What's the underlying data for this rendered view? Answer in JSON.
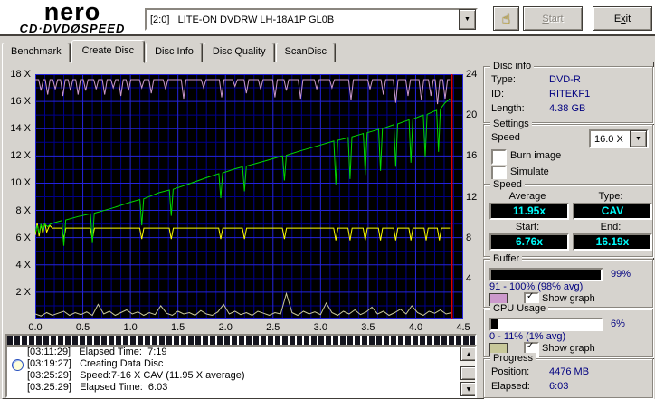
{
  "header": {
    "logo": {
      "name": "nero",
      "line2_left": "CD·DVD",
      "line2_disc": "Ø",
      "line2_right": "SPEED"
    },
    "drive_select": "[2:0]   LITE-ON DVDRW LH-18A1P GL0B",
    "start_u": "S",
    "start_rest": "tart",
    "exit_pre": "E",
    "exit_u": "x",
    "exit_rest": "it"
  },
  "icons": {
    "hand": "☝",
    "dropdown": "▼",
    "up": "▲",
    "down": "▼",
    "check": "✓"
  },
  "tabs": [
    {
      "label": "Benchmark",
      "active": false
    },
    {
      "label": "Create Disc",
      "active": true
    },
    {
      "label": "Disc Info",
      "active": false
    },
    {
      "label": "Disc Quality",
      "active": false
    },
    {
      "label": "ScanDisc",
      "active": false
    }
  ],
  "chart_data": {
    "type": "line",
    "title": "",
    "xlim": [
      0,
      4.5
    ],
    "ylim_left": [
      0,
      18
    ],
    "ylim_right": [
      0,
      24
    ],
    "grid": {
      "x_minor": 0.1,
      "x_major": 0.5,
      "y_minor": 1,
      "y_major": 2,
      "minor_color": "#00008c",
      "major_color": "#2424dd"
    },
    "x_ticks": [
      [
        0,
        "0.0"
      ],
      [
        0.5,
        "0.5"
      ],
      [
        1,
        "1.0"
      ],
      [
        1.5,
        "1.5"
      ],
      [
        2,
        "2.0"
      ],
      [
        2.5,
        "2.5"
      ],
      [
        3,
        "3.0"
      ],
      [
        3.5,
        "3.5"
      ],
      [
        4,
        "4.0"
      ],
      [
        4.5,
        "4.5"
      ]
    ],
    "left_ticks": [
      [
        18,
        "18 X"
      ],
      [
        16,
        "16 X"
      ],
      [
        14,
        "14 X"
      ],
      [
        12,
        "12 X"
      ],
      [
        10,
        "10 X"
      ],
      [
        8,
        "8 X"
      ],
      [
        6,
        "6 X"
      ],
      [
        4,
        "4 X"
      ],
      [
        2,
        "2 X"
      ]
    ],
    "right_ticks": [
      [
        18,
        "24"
      ],
      [
        15,
        "20"
      ],
      [
        12,
        "16"
      ],
      [
        9,
        "12"
      ],
      [
        6,
        "8"
      ],
      [
        3,
        "4"
      ]
    ],
    "end_marker_x": 4.38,
    "end_marker_color": "#dd0000",
    "series": [
      {
        "name": "cpu-usage",
        "color": "#c8c89a",
        "x0": 0,
        "dx": 0.06,
        "values": [
          0.4,
          0.25,
          0.5,
          0.3,
          0.45,
          0.6,
          0.3,
          0.5,
          0.35,
          0.55,
          0.3,
          1.1,
          0.4,
          0.6,
          0.3,
          0.5,
          0.7,
          0.4,
          0.55,
          0.3,
          0.5,
          0.35,
          1.0,
          0.45,
          0.3,
          0.6,
          0.4,
          0.5,
          0.3,
          0.65,
          0.4,
          0.3,
          0.55,
          1.1,
          0.4,
          0.6,
          0.35,
          0.5,
          0.3,
          0.6,
          0.45,
          0.3,
          0.5,
          0.4,
          1.9,
          0.5,
          0.3,
          0.6,
          0.4,
          0.55,
          0.35,
          1.2,
          0.5,
          0.3,
          0.6,
          0.4,
          0.7,
          0.35,
          0.55,
          0.9,
          0.4,
          0.6,
          0.3,
          0.5,
          0.75,
          0.4,
          1.0,
          0.5,
          0.3,
          0.6,
          0.45,
          0.7,
          0.4,
          0.5
        ]
      },
      {
        "name": "buffer-level",
        "color": "#cc99cc",
        "baseline": 17.6,
        "range": [
          0,
          4.36
        ],
        "hw": 0.025,
        "dips": [
          [
            0.06,
            16.8
          ],
          [
            0.13,
            16.5
          ],
          [
            0.21,
            16.9
          ],
          [
            0.29,
            16.4
          ],
          [
            0.37,
            16.8
          ],
          [
            0.45,
            16.5
          ],
          [
            0.53,
            16.8
          ],
          [
            0.64,
            16.9
          ],
          [
            0.73,
            16.5
          ],
          [
            0.82,
            17.0
          ],
          [
            0.9,
            16.4
          ],
          [
            0.98,
            16.8
          ],
          [
            1.12,
            17.0
          ],
          [
            1.22,
            16.6
          ],
          [
            1.37,
            16.9
          ],
          [
            1.56,
            16.2
          ],
          [
            1.77,
            17.0
          ],
          [
            1.96,
            16.3
          ],
          [
            2.1,
            17.1
          ],
          [
            2.22,
            16.6
          ],
          [
            2.37,
            16.9
          ],
          [
            2.52,
            16.3
          ],
          [
            2.64,
            16.8
          ],
          [
            2.79,
            16.2
          ],
          [
            2.96,
            16.9
          ],
          [
            3.12,
            17.0
          ],
          [
            3.32,
            16.1
          ],
          [
            3.52,
            16.9
          ],
          [
            3.66,
            16.5
          ],
          [
            3.79,
            15.9
          ],
          [
            3.92,
            16.4
          ],
          [
            4.06,
            16.1
          ],
          [
            4.16,
            16.4
          ],
          [
            4.23,
            15.8
          ],
          [
            4.31,
            16.2
          ]
        ]
      },
      {
        "name": "yellow-line",
        "color": "#ffff00",
        "baseline": 6.7,
        "range": [
          0.18,
          4.36
        ],
        "hw": 0.022,
        "head": [
          [
            0,
            6.2
          ],
          [
            0.02,
            7.1
          ],
          [
            0.04,
            6.1
          ],
          [
            0.06,
            7.0
          ],
          [
            0.08,
            6.3
          ],
          [
            0.1,
            7.1
          ],
          [
            0.12,
            6.4
          ],
          [
            0.15,
            6.9
          ]
        ],
        "dips": [
          [
            0.3,
            5.9
          ],
          [
            0.6,
            5.9
          ],
          [
            1.12,
            5.9
          ],
          [
            1.43,
            5.9
          ],
          [
            1.95,
            5.9
          ],
          [
            2.2,
            5.9
          ],
          [
            2.62,
            5.9
          ],
          [
            3.16,
            5.8
          ],
          [
            3.31,
            5.8
          ],
          [
            3.47,
            5.8
          ],
          [
            3.63,
            5.8
          ],
          [
            3.79,
            5.8
          ],
          [
            3.95,
            5.8
          ],
          [
            4.11,
            5.8
          ],
          [
            4.25,
            5.8
          ]
        ]
      },
      {
        "name": "write-speed",
        "color": "#00d800",
        "points": [
          [
            0,
            6.4
          ],
          [
            0.02,
            6.9
          ],
          [
            0.04,
            6.3
          ],
          [
            0.06,
            7.0
          ],
          [
            0.08,
            6.5
          ],
          [
            0.1,
            7.0
          ],
          [
            0.13,
            6.8
          ],
          [
            0.16,
            7.0
          ],
          [
            0.2,
            7.1
          ],
          [
            0.28,
            7.25
          ],
          [
            0.3,
            5.4
          ],
          [
            0.32,
            7.3
          ],
          [
            0.45,
            7.55
          ],
          [
            0.58,
            7.75
          ],
          [
            0.6,
            5.6
          ],
          [
            0.62,
            7.8
          ],
          [
            0.8,
            8.15
          ],
          [
            1.0,
            8.6
          ],
          [
            1.1,
            8.8
          ],
          [
            1.12,
            6.9
          ],
          [
            1.14,
            8.85
          ],
          [
            1.3,
            9.3
          ],
          [
            1.41,
            9.5
          ],
          [
            1.43,
            7.6
          ],
          [
            1.45,
            9.55
          ],
          [
            1.6,
            9.9
          ],
          [
            1.8,
            10.4
          ],
          [
            1.93,
            10.7
          ],
          [
            1.95,
            8.9
          ],
          [
            1.97,
            10.75
          ],
          [
            2.1,
            11.05
          ],
          [
            2.18,
            11.2
          ],
          [
            2.2,
            9.4
          ],
          [
            2.22,
            11.25
          ],
          [
            2.4,
            11.6
          ],
          [
            2.6,
            12.0
          ],
          [
            2.62,
            10.2
          ],
          [
            2.64,
            12.05
          ],
          [
            2.8,
            12.4
          ],
          [
            3.0,
            12.8
          ],
          [
            3.12,
            13.05
          ],
          [
            3.14,
            13.1
          ],
          [
            3.16,
            9.9
          ],
          [
            3.18,
            13.15
          ],
          [
            3.27,
            13.3
          ],
          [
            3.29,
            13.35
          ],
          [
            3.31,
            10.3
          ],
          [
            3.33,
            13.4
          ],
          [
            3.43,
            13.6
          ],
          [
            3.45,
            13.65
          ],
          [
            3.47,
            10.6
          ],
          [
            3.49,
            13.7
          ],
          [
            3.59,
            13.9
          ],
          [
            3.61,
            13.95
          ],
          [
            3.63,
            10.9
          ],
          [
            3.65,
            14.0
          ],
          [
            3.75,
            14.25
          ],
          [
            3.77,
            14.3
          ],
          [
            3.79,
            11.2
          ],
          [
            3.81,
            14.35
          ],
          [
            3.91,
            14.6
          ],
          [
            3.93,
            14.65
          ],
          [
            3.95,
            11.5
          ],
          [
            3.97,
            14.7
          ],
          [
            4.06,
            14.95
          ],
          [
            4.08,
            15.0
          ],
          [
            4.1,
            11.9
          ],
          [
            4.12,
            15.05
          ],
          [
            4.2,
            15.3
          ],
          [
            4.22,
            15.35
          ],
          [
            4.24,
            12.3
          ],
          [
            4.26,
            15.45
          ],
          [
            4.31,
            15.9
          ],
          [
            4.36,
            16.2
          ]
        ]
      }
    ]
  },
  "disc_info": {
    "title": "Disc info",
    "rows": [
      [
        "Type:",
        "DVD-R"
      ],
      [
        "ID:",
        "RITEKF1"
      ],
      [
        "Length:",
        "4.38 GB"
      ]
    ]
  },
  "settings": {
    "title": "Settings",
    "speed_label": "Speed",
    "speed_value": "16.0 X",
    "checkboxes": [
      {
        "label": "Burn image",
        "checked": false
      },
      {
        "label": "Simulate",
        "checked": false
      }
    ]
  },
  "speed": {
    "title": "Speed",
    "cells": [
      {
        "label": "Average",
        "value": "11.95x"
      },
      {
        "label": "Type:",
        "value": "CAV"
      },
      {
        "label": "Start:",
        "value": "6.76x"
      },
      {
        "label": "End:",
        "value": "16.19x"
      }
    ]
  },
  "buffer": {
    "title": "Buffer",
    "percent": 99,
    "percent_label": "99%",
    "range_text": "91 - 100% (98% avg)",
    "show_graph_label": "Show graph",
    "swatch_color": "#cc99cc",
    "checked": true
  },
  "cpu": {
    "title": "CPU Usage",
    "percent": 6,
    "percent_label": "6%",
    "range_text": "0 - 11% (1% avg)",
    "show_graph_label": "Show graph",
    "swatch_color": "#c8c89a",
    "checked": true
  },
  "progress": {
    "title": "Progress",
    "rows": [
      [
        "Position:",
        "4476 MB"
      ],
      [
        "Elapsed:",
        "6:03"
      ]
    ]
  },
  "log": {
    "lines": [
      {
        "icon": false,
        "time": "[03:11:29]",
        "text": "Elapsed Time:  7:19"
      },
      {
        "icon": true,
        "time": "[03:19:27]",
        "text": "Creating Data Disc"
      },
      {
        "icon": false,
        "time": "[03:25:29]",
        "text": "Speed:7-16 X CAV (11.95 X average)"
      },
      {
        "icon": false,
        "time": "[03:25:29]",
        "text": "Elapsed Time:  6:03"
      }
    ]
  }
}
